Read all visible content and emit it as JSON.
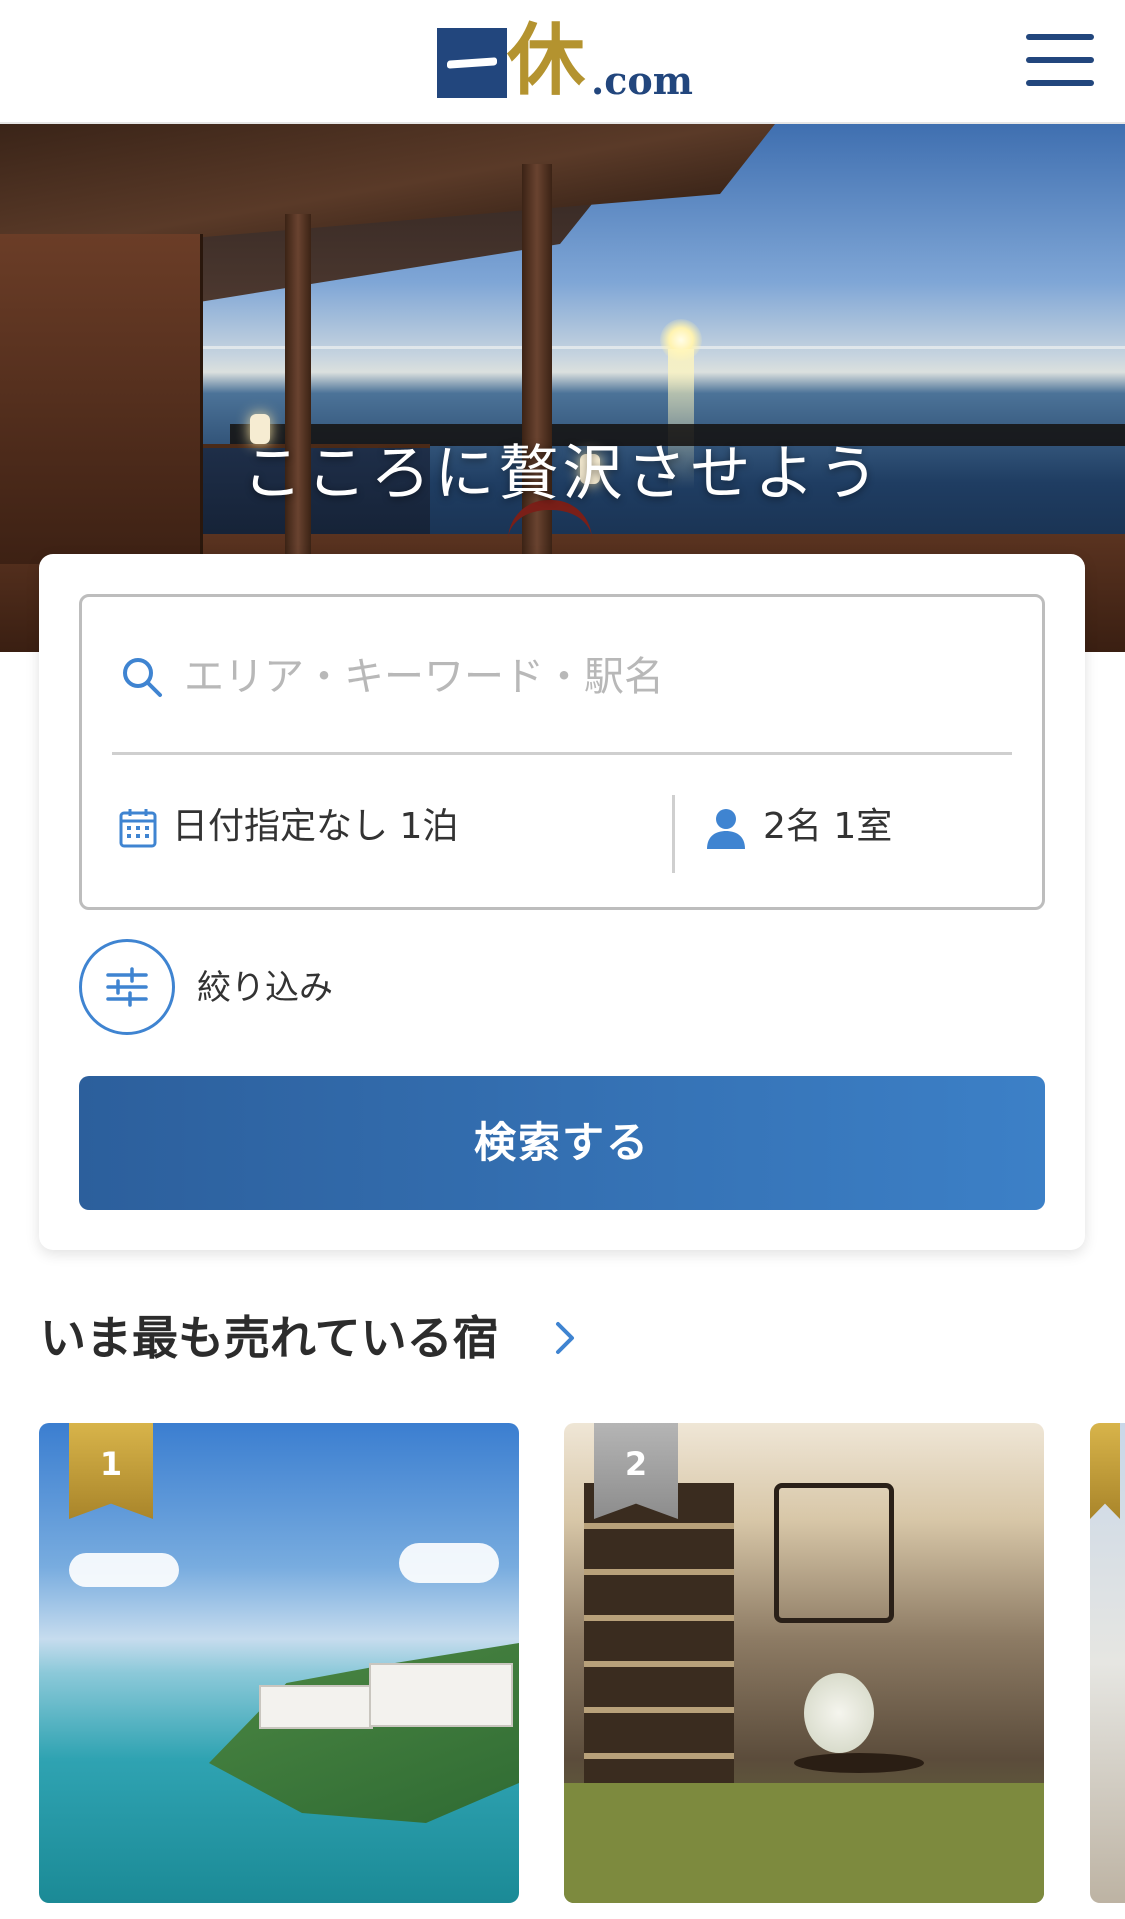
{
  "header": {
    "logo": {
      "kanji": "休",
      "suffix": ".com"
    },
    "menu_icon": "hamburger-menu-icon"
  },
  "hero": {
    "tagline": "こころに贅沢させよう"
  },
  "search": {
    "keyword_placeholder": "エリア・キーワード・駅名",
    "date_label": "日付指定なし 1泊",
    "guests_label": "2名 1室",
    "filter_label": "絞り込み",
    "submit_label": "検索する"
  },
  "ranking": {
    "title": "いま最も売れている宿",
    "items": [
      {
        "rank": "1"
      },
      {
        "rank": "2"
      },
      {
        "rank": ""
      }
    ]
  },
  "colors": {
    "brand_navy": "#22467d",
    "brand_gold": "#b4932f",
    "accent_blue": "#3f84d1",
    "button_blue": "#2c5f9c"
  }
}
